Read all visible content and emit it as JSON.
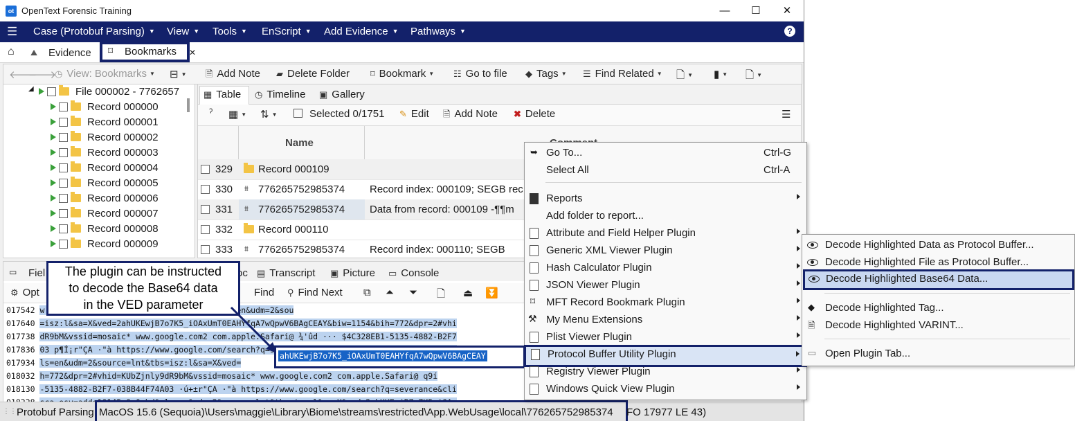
{
  "window": {
    "title": "OpenText Forensic Training",
    "logo": "ot"
  },
  "menubar": {
    "items": [
      "Case (Protobuf Parsing)",
      "View",
      "Tools",
      "EnScript",
      "Add Evidence",
      "Pathways"
    ],
    "help_icon": "help-icon"
  },
  "nav_tabs": {
    "home_icon": "home-icon",
    "evidence": "Evidence",
    "bookmarks": "Bookmarks"
  },
  "toolbar": {
    "view": "View: Bookmarks",
    "add_note": "Add Note",
    "delete_folder": "Delete Folder",
    "bookmark": "Bookmark",
    "go_to_file": "Go to file",
    "tags": "Tags",
    "find_related": "Find Related"
  },
  "tree": {
    "root": "File 000002 - 7762657",
    "records": [
      "Record 000000",
      "Record 000001",
      "Record 000002",
      "Record 000003",
      "Record 000004",
      "Record 000005",
      "Record 000006",
      "Record 000007",
      "Record 000008",
      "Record 000009"
    ]
  },
  "right_tabs": {
    "table": "Table",
    "timeline": "Timeline",
    "gallery": "Gallery"
  },
  "table_toolbar": {
    "selected": "Selected 0/1751",
    "edit": "Edit",
    "add_note": "Add Note",
    "delete": "Delete"
  },
  "table": {
    "headers": {
      "name": "Name",
      "comment": "Comment"
    },
    "rows": [
      {
        "num": "329",
        "name": "Record 000109",
        "comment": "",
        "type": "folder"
      },
      {
        "num": "330",
        "name": "776265752985374",
        "comment": "Record index: 000109; SEGB rec",
        "type": "file"
      },
      {
        "num": "331",
        "name": "776265752985374",
        "comment": "Data from record: 000109 -¶¶m",
        "type": "file"
      },
      {
        "num": "332",
        "name": "Record 000110",
        "comment": "",
        "type": "folder"
      },
      {
        "num": "333",
        "name": "776265752985374",
        "comment": "Record index: 000110; SEGB",
        "type": "file"
      }
    ]
  },
  "bottom_tabs": {
    "fields": "Fiel",
    "doc": "oc",
    "transcript": "Transcript",
    "picture": "Picture",
    "console": "Console"
  },
  "bottom_toolbar": {
    "options": "Opt",
    "find": "Find",
    "find_next": "Find Next"
  },
  "hex_lines": [
    {
      "off": "017542",
      "text": "w                                       nt=safari&sca_esv=adde10145c0e0ebd&rls=en&udm=2&sou"
    },
    {
      "off": "017640",
      "text": "=isz:l&sa=X&ved=2ahUKEwjB7o7K5_iOAxUmT0EAHYfqA7wQpwV6BAgCEAY&biw=1154&bih=772&dpr=2#vhi"
    },
    {
      "off": "017738",
      "text": "dR9bM&vssid=mosaic* www.google.com2 com.apple.Safari@ ¾'ûd ··· $4C328EB1-5135-4882-B2F7"
    },
    {
      "off": "017836",
      "text": "03 p¶Í¡r\"ÇA ·\"à https://www.google.com/search?q=severance&client=safari&sca_esv=adde101"
    },
    {
      "off": "017934",
      "text": "ls=en&udm=2&source=lnt&tbs=isz:l&sa=X&ved="
    },
    {
      "off": "018032",
      "text": "h=772&dpr=2#vhid=KUbZjnly9dR9bM&vssid=mosaic* www.google.com2 com.apple.Safari@ q9í"
    },
    {
      "off": "018130",
      "text": "-5135-4882-B2F7-038B44F74A03 ·ú+±r\"ÇA ·\"à https://www.google.com/search?q=severance&cli"
    },
    {
      "off": "018228",
      "text": "sca_esv=adde10145c0e0ebd&rls=en&udm=2&source=lnt&tbs=isz:l&sa=X&ved=2ahUKEwjB7o7K5_iOAx"
    }
  ],
  "highlighted_text": "ahUKEwjB7o7K5_iOAxUmT0EAHYfqA7wQpwV6BAgCEAY",
  "callout": [
    "The plugin can be instructed",
    "to decode the Base64 data",
    "in the VED parameter"
  ],
  "status": {
    "case": "Protobuf Parsing",
    "path": "MacOS 15.6 (Sequoia)\\Users\\maggie\\Library\\Biome\\streams\\restricted\\App.WebUsage\\local\\776265752985374",
    "offset": "FO 17977 LE 43)"
  },
  "context_menu": {
    "items": [
      {
        "label": "Go To...",
        "shortcut": "Ctrl-G",
        "icon": "arrow-icon"
      },
      {
        "label": "Select All",
        "shortcut": "Ctrl-A"
      },
      {
        "label": "Reports",
        "submenu": true,
        "icon": "report-icon"
      },
      {
        "label": "Add folder to report..."
      },
      {
        "label": "Attribute and Field Helper Plugin",
        "submenu": true
      },
      {
        "label": "Generic XML Viewer Plugin",
        "submenu": true
      },
      {
        "label": "Hash Calculator Plugin",
        "submenu": true
      },
      {
        "label": "JSON Viewer Plugin",
        "submenu": true
      },
      {
        "label": "MFT Record Bookmark Plugin",
        "submenu": true
      },
      {
        "label": "My Menu Extensions",
        "submenu": true
      },
      {
        "label": "Plist Viewer Plugin",
        "submenu": true
      },
      {
        "label": "Protocol Buffer Utility Plugin",
        "submenu": true
      },
      {
        "label": "Registry Viewer Plugin",
        "submenu": true
      },
      {
        "label": "Windows Quick View Plugin",
        "submenu": true
      }
    ]
  },
  "submenu": {
    "items": [
      {
        "label": "Decode Highlighted Data as Protocol Buffer..."
      },
      {
        "label": "Decode Highlighted File as Protocol Buffer..."
      },
      {
        "label": "Decode Highlighted Base64 Data..."
      },
      {
        "label": "Decode Highlighted Tag..."
      },
      {
        "label": "Decode Highlighted VARINT..."
      },
      {
        "label": "Open Plugin Tab..."
      }
    ]
  },
  "colors": {
    "navy": "#13216a",
    "accent": "#1763c6",
    "folder": "#f3c445"
  }
}
